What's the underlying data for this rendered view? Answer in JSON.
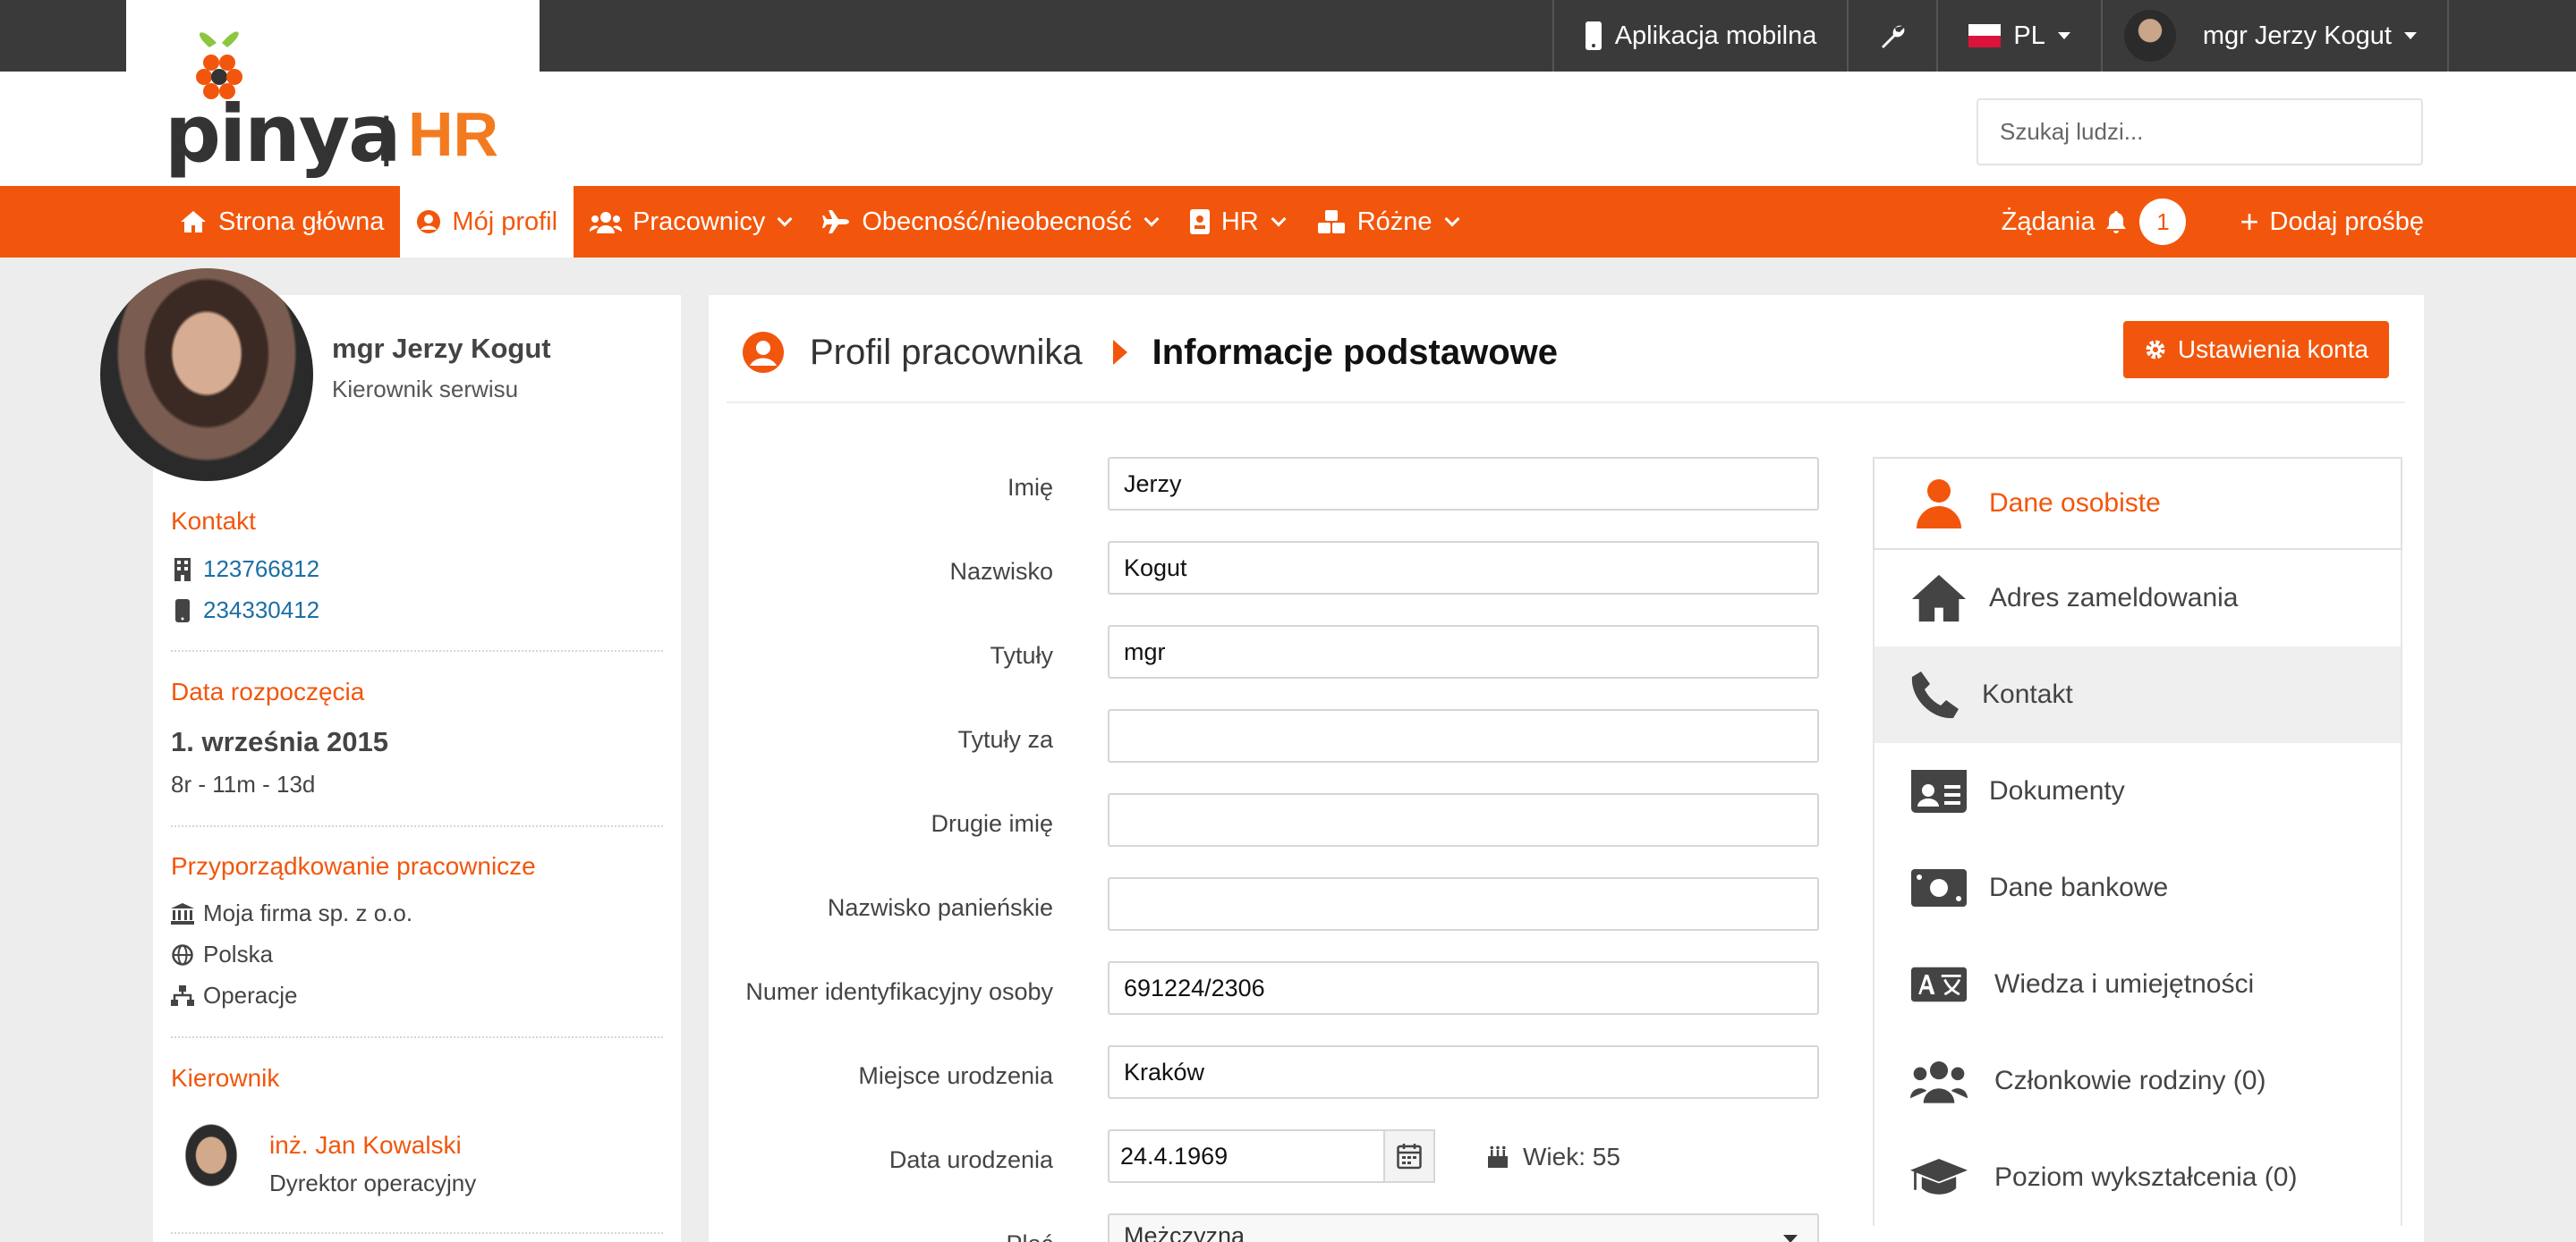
{
  "topbar": {
    "mobile_app": "Aplikacja mobilna",
    "language": "PL",
    "user": "mgr Jerzy Kogut"
  },
  "brand": {
    "logo_text": "pinya",
    "separator": "|",
    "suffix": "HR"
  },
  "search": {
    "placeholder": "Szukaj ludzi..."
  },
  "nav": {
    "items": [
      {
        "label": "Strona główna",
        "icon": "home-icon"
      },
      {
        "label": "Mój profil",
        "icon": "user-circle-icon",
        "active": true
      },
      {
        "label": "Pracownicy",
        "icon": "users-icon"
      },
      {
        "label": "Obecność/nieobecność",
        "icon": "plane-icon"
      },
      {
        "label": "HR",
        "icon": "id-badge-icon"
      },
      {
        "label": "Różne",
        "icon": "cubes-icon"
      }
    ],
    "requests": "Żądania",
    "requests_count": "1",
    "add_request": "Dodaj prośbę"
  },
  "profile": {
    "name": "mgr Jerzy Kogut",
    "role": "Kierownik serwisu",
    "contact_title": "Kontakt",
    "phone_office": "123766812",
    "phone_mobile": "234330412",
    "start_title": "Data rozpoczęcia",
    "start_date": "1. września 2015",
    "tenure": "8r - 11m - 13d",
    "assignment_title": "Przyporządkowanie pracownicze",
    "company": "Moja firma sp. z o.o.",
    "country": "Polska",
    "department": "Operacje",
    "manager_title": "Kierownik",
    "manager_name": "inż. Jan Kowalski",
    "manager_role": "Dyrektor operacyjny"
  },
  "main": {
    "breadcrumb": "Profil pracownika",
    "section": "Informacje podstawowe",
    "settings_button": "Ustawienia konta",
    "fields": {
      "first_name_label": "Imię",
      "first_name": "Jerzy",
      "last_name_label": "Nazwisko",
      "last_name": "Kogut",
      "titles_label": "Tytuły",
      "titles": "mgr",
      "titles_after_label": "Tytuły za",
      "titles_after": "",
      "middle_name_label": "Drugie imię",
      "middle_name": "",
      "maiden_name_label": "Nazwisko panieńskie",
      "maiden_name": "",
      "id_number_label": "Numer identyfikacyjny osoby",
      "id_number": "691224/2306",
      "birthplace_label": "Miejsce urodzenia",
      "birthplace": "Kraków",
      "birthdate_label": "Data urodzenia",
      "birthdate": "24.4.1969",
      "age": "Wiek: 55",
      "gender_label": "Płeć",
      "gender": "Mężczyzna"
    }
  },
  "side_menu": [
    {
      "label": "Dane osobiste",
      "icon": "user-icon"
    },
    {
      "label": "Adres zameldowania",
      "icon": "home-icon"
    },
    {
      "label": "Kontakt",
      "icon": "phone-icon"
    },
    {
      "label": "Dokumenty",
      "icon": "id-card-icon"
    },
    {
      "label": "Dane bankowe",
      "icon": "money-bill-icon"
    },
    {
      "label": "Wiedza i umiejętności",
      "icon": "language-icon"
    },
    {
      "label": "Członkowie rodziny  (0)",
      "icon": "users-icon"
    },
    {
      "label": "Poziom wykształcenia  (0)",
      "icon": "graduation-cap-icon"
    }
  ],
  "colors": {
    "accent": "#f2560c",
    "topbar": "#3a3a3a",
    "link": "#1c6ea4",
    "logo_orange": "#f37b1f"
  }
}
